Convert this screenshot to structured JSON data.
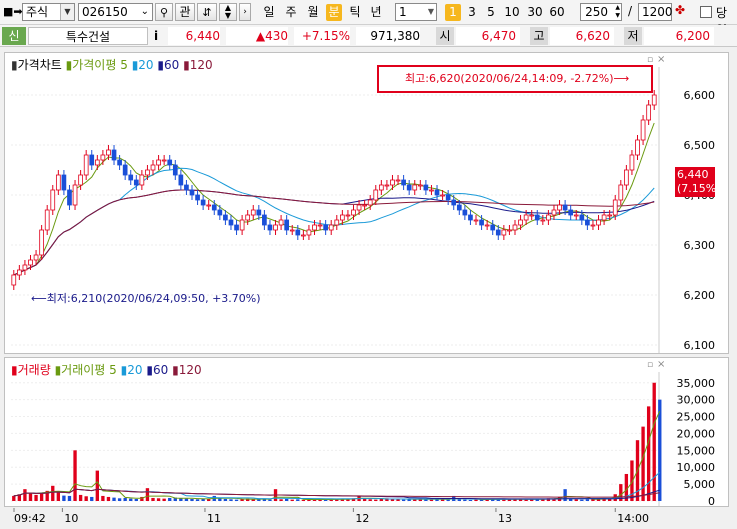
{
  "toolbar": {
    "market": "주식",
    "code": "026150",
    "search_label": "관",
    "timeframes": [
      "일",
      "주",
      "월",
      "분",
      "틱",
      "년"
    ],
    "selected_timeframe": "분",
    "interval_value": "1",
    "minute_buttons": [
      "1",
      "3",
      "5",
      "10",
      "30",
      "60"
    ],
    "selected_minute": "1",
    "count_value": "250",
    "total_value": "1200",
    "checkbox_label": "당일"
  },
  "quote": {
    "market_flag": "신",
    "name": "특수건설",
    "info_label": "i",
    "price": "6,440",
    "change": "▲430",
    "change_pct": "+7.15%",
    "volume": "971,380",
    "open_label": "시",
    "open": "6,470",
    "high_label": "고",
    "high": "6,620",
    "low_label": "저",
    "low": "6,200"
  },
  "price_panel": {
    "legend": [
      "가격차트",
      "가격이평",
      "5",
      "20",
      "60",
      "120"
    ],
    "max_annotation": "최고:6,620(2020/06/24,14:09, -2.72%)⟶",
    "min_annotation": "⟵최저:6,210(2020/06/24,09:50, +3.70%)",
    "current_price": "6,440",
    "current_pct": "(7.15%)"
  },
  "volume_panel": {
    "legend": [
      "거래량",
      "거래이평",
      "5",
      "20",
      "60",
      "120"
    ]
  },
  "colors": {
    "up": "#e0001b",
    "ma5": "#6a9a10",
    "ma20": "#1a9ad8",
    "ma60": "#1a1a8a",
    "ma120": "#8a1a3a"
  },
  "chart_data": [
    {
      "type": "candlestick",
      "yticks": [
        "6,600",
        "6,500",
        "6,400",
        "6,300",
        "6,200",
        "6,100"
      ],
      "ylim": [
        6100,
        6600
      ],
      "xticks": [
        "09:42",
        "10",
        "11",
        "12",
        "13",
        "14:00"
      ],
      "candle_closes": [
        6240,
        6250,
        6260,
        6270,
        6280,
        6330,
        6370,
        6410,
        6440,
        6410,
        6380,
        6420,
        6440,
        6480,
        6460,
        6470,
        6480,
        6490,
        6470,
        6460,
        6440,
        6430,
        6420,
        6440,
        6450,
        6460,
        6470,
        6470,
        6460,
        6440,
        6420,
        6410,
        6400,
        6390,
        6380,
        6380,
        6370,
        6360,
        6350,
        6340,
        6330,
        6350,
        6360,
        6370,
        6360,
        6340,
        6330,
        6340,
        6350,
        6330,
        6330,
        6320,
        6320,
        6330,
        6340,
        6340,
        6330,
        6340,
        6350,
        6360,
        6360,
        6370,
        6380,
        6380,
        6390,
        6410,
        6420,
        6420,
        6430,
        6430,
        6420,
        6410,
        6420,
        6420,
        6410,
        6410,
        6400,
        6400,
        6390,
        6380,
        6370,
        6360,
        6350,
        6350,
        6340,
        6340,
        6330,
        6320,
        6330,
        6330,
        6340,
        6350,
        6360,
        6360,
        6350,
        6350,
        6360,
        6370,
        6380,
        6370,
        6360,
        6360,
        6350,
        6340,
        6340,
        6350,
        6360,
        6360,
        6390,
        6420,
        6450,
        6480,
        6510,
        6550,
        6580,
        6600
      ],
      "volume": [
        1500,
        2000,
        3500,
        2500,
        1800,
        2200,
        3000,
        4500,
        2800,
        1600,
        1500,
        15000,
        1800,
        1400,
        1200,
        9000,
        1500,
        1200,
        1000,
        800,
        900,
        700,
        600,
        1200,
        3800,
        900,
        800,
        700,
        900,
        1000,
        800,
        700,
        600,
        500,
        700,
        600,
        1500,
        800,
        600,
        500,
        400,
        600,
        700,
        500,
        600,
        500,
        400,
        3500,
        500,
        600,
        400,
        500,
        300,
        400,
        600,
        500,
        400,
        300,
        500,
        600,
        700,
        800,
        1500,
        600,
        500,
        400,
        700,
        800,
        600,
        500,
        400,
        500,
        600,
        700,
        500,
        400,
        600,
        500,
        400,
        1500,
        500,
        400,
        300,
        400,
        500,
        600,
        500,
        400,
        500,
        600,
        700,
        500,
        400,
        500,
        600,
        700,
        800,
        600,
        1200,
        3500,
        600,
        500,
        400,
        500,
        600,
        700,
        800,
        600,
        2000,
        5000,
        8000,
        12000,
        18000,
        22000,
        28000,
        35000,
        30000
      ],
      "volume_yticks": [
        "35,000",
        "30,000",
        "25,000",
        "20,000",
        "15,000",
        "10,000",
        "5,000",
        "0"
      ],
      "volume_ylim": [
        0,
        37000
      ]
    }
  ]
}
